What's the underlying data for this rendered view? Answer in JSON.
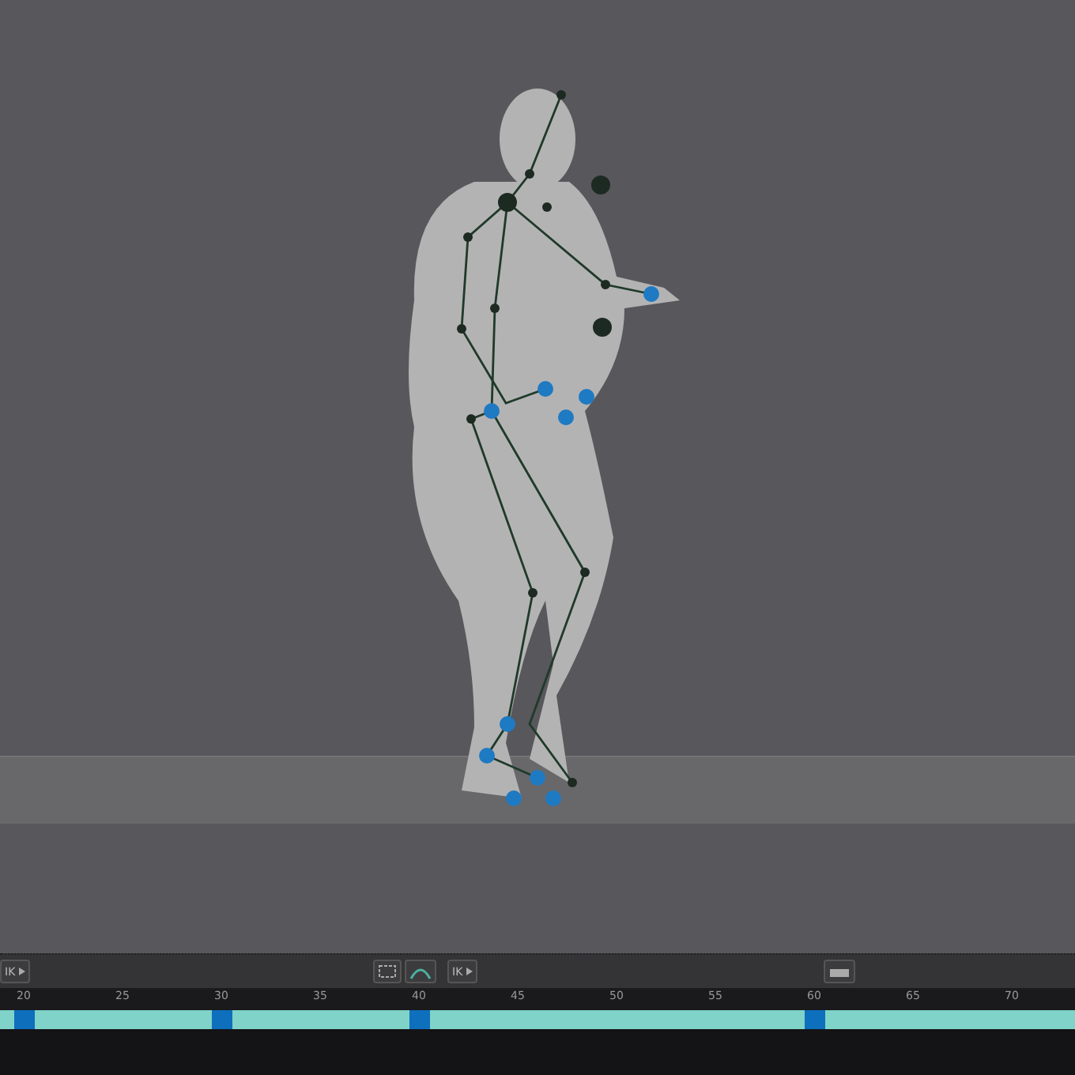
{
  "toolbar": {
    "buttons": [
      {
        "kind": "ik",
        "label": "IK"
      },
      {
        "kind": "frame"
      },
      {
        "kind": "curve"
      },
      {
        "kind": "ik",
        "label": "IK"
      },
      {
        "kind": "camera"
      }
    ]
  },
  "timeline": {
    "ticks": [
      {
        "label": "20",
        "key": true
      },
      {
        "label": "25",
        "key": false
      },
      {
        "label": "30",
        "key": true
      },
      {
        "label": "35",
        "key": false
      },
      {
        "label": "40",
        "key": true
      },
      {
        "label": "45",
        "key": false
      },
      {
        "label": "50",
        "key": false
      },
      {
        "label": "55",
        "key": false
      },
      {
        "label": "60",
        "key": true
      },
      {
        "label": "65",
        "key": false
      },
      {
        "label": "70",
        "key": false
      }
    ]
  }
}
